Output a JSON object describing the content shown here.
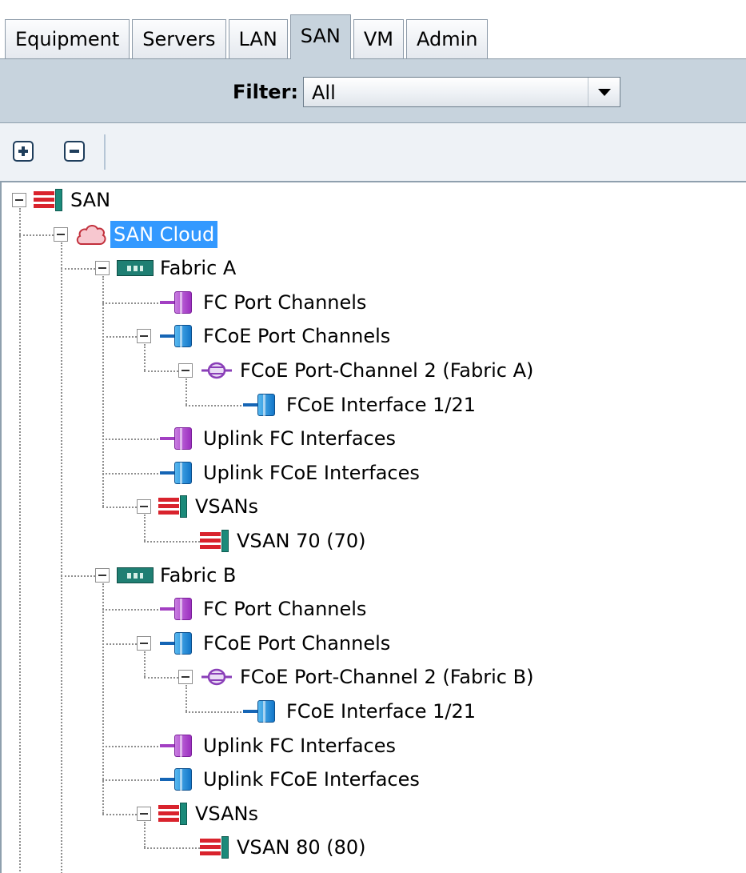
{
  "tabs": [
    {
      "id": "equipment",
      "label": "Equipment",
      "active": false
    },
    {
      "id": "servers",
      "label": "Servers",
      "active": false
    },
    {
      "id": "lan",
      "label": "LAN",
      "active": false
    },
    {
      "id": "san",
      "label": "SAN",
      "active": true
    },
    {
      "id": "vm",
      "label": "VM",
      "active": false
    },
    {
      "id": "admin",
      "label": "Admin",
      "active": false
    }
  ],
  "filter": {
    "label": "Filter:",
    "value": "All"
  },
  "toolbar": {
    "expand": "expand-all",
    "collapse": "collapse-all"
  },
  "icons": {
    "vsan": "vsan-icon",
    "cloud": "cloud-icon",
    "fabric": "fabric-interconnect-icon",
    "fc_port": "fc-port-icon",
    "fcoe_port": "fcoe-port-icon",
    "port_channel": "port-channel-icon"
  },
  "colors": {
    "selected": "#3399ff",
    "filter_bar": "#c7d3dd",
    "vsan_red": "#d9232d",
    "fc_purple": "#a23fc2",
    "fcoe_blue": "#1477c9"
  },
  "tree": [
    {
      "id": "san",
      "label": "SAN",
      "icon": "vsan",
      "toggle": "expanded"
    },
    {
      "id": "san-cloud",
      "label": "SAN Cloud",
      "icon": "cloud",
      "toggle": "expanded",
      "selected": true
    },
    {
      "id": "fabric-a",
      "label": "Fabric A",
      "icon": "fabric",
      "toggle": "expanded"
    },
    {
      "id": "fa-fc-pc",
      "label": "FC Port Channels",
      "icon": "fc_port",
      "toggle": null
    },
    {
      "id": "fa-fcoe-pc",
      "label": "FCoE Port Channels",
      "icon": "fcoe_port",
      "toggle": "expanded"
    },
    {
      "id": "fa-fcoe-pc2",
      "label": "FCoE Port-Channel 2 (Fabric A)",
      "icon": "port_channel",
      "toggle": "expanded"
    },
    {
      "id": "fa-fcoe-if",
      "label": "FCoE Interface 1/21",
      "icon": "fcoe_port",
      "toggle": null
    },
    {
      "id": "fa-uplink-fc",
      "label": "Uplink FC Interfaces",
      "icon": "fc_port",
      "toggle": null
    },
    {
      "id": "fa-uplink-fcoe",
      "label": "Uplink FCoE Interfaces",
      "icon": "fcoe_port",
      "toggle": null
    },
    {
      "id": "fa-vsans",
      "label": "VSANs",
      "icon": "vsan",
      "toggle": "expanded"
    },
    {
      "id": "fa-vsan70",
      "label": "VSAN 70 (70)",
      "icon": "vsan",
      "toggle": null
    },
    {
      "id": "fabric-b",
      "label": "Fabric B",
      "icon": "fabric",
      "toggle": "expanded"
    },
    {
      "id": "fb-fc-pc",
      "label": "FC Port Channels",
      "icon": "fc_port",
      "toggle": null
    },
    {
      "id": "fb-fcoe-pc",
      "label": "FCoE Port Channels",
      "icon": "fcoe_port",
      "toggle": "expanded"
    },
    {
      "id": "fb-fcoe-pc2",
      "label": "FCoE Port-Channel 2 (Fabric B)",
      "icon": "port_channel",
      "toggle": "expanded"
    },
    {
      "id": "fb-fcoe-if",
      "label": "FCoE Interface 1/21",
      "icon": "fcoe_port",
      "toggle": null
    },
    {
      "id": "fb-uplink-fc",
      "label": "Uplink FC Interfaces",
      "icon": "fc_port",
      "toggle": null
    },
    {
      "id": "fb-uplink-fcoe",
      "label": "Uplink FCoE Interfaces",
      "icon": "fcoe_port",
      "toggle": null
    },
    {
      "id": "fb-vsans",
      "label": "VSANs",
      "icon": "vsan",
      "toggle": "expanded"
    },
    {
      "id": "fb-vsan80",
      "label": "VSAN 80 (80)",
      "icon": "vsan",
      "toggle": null
    }
  ]
}
